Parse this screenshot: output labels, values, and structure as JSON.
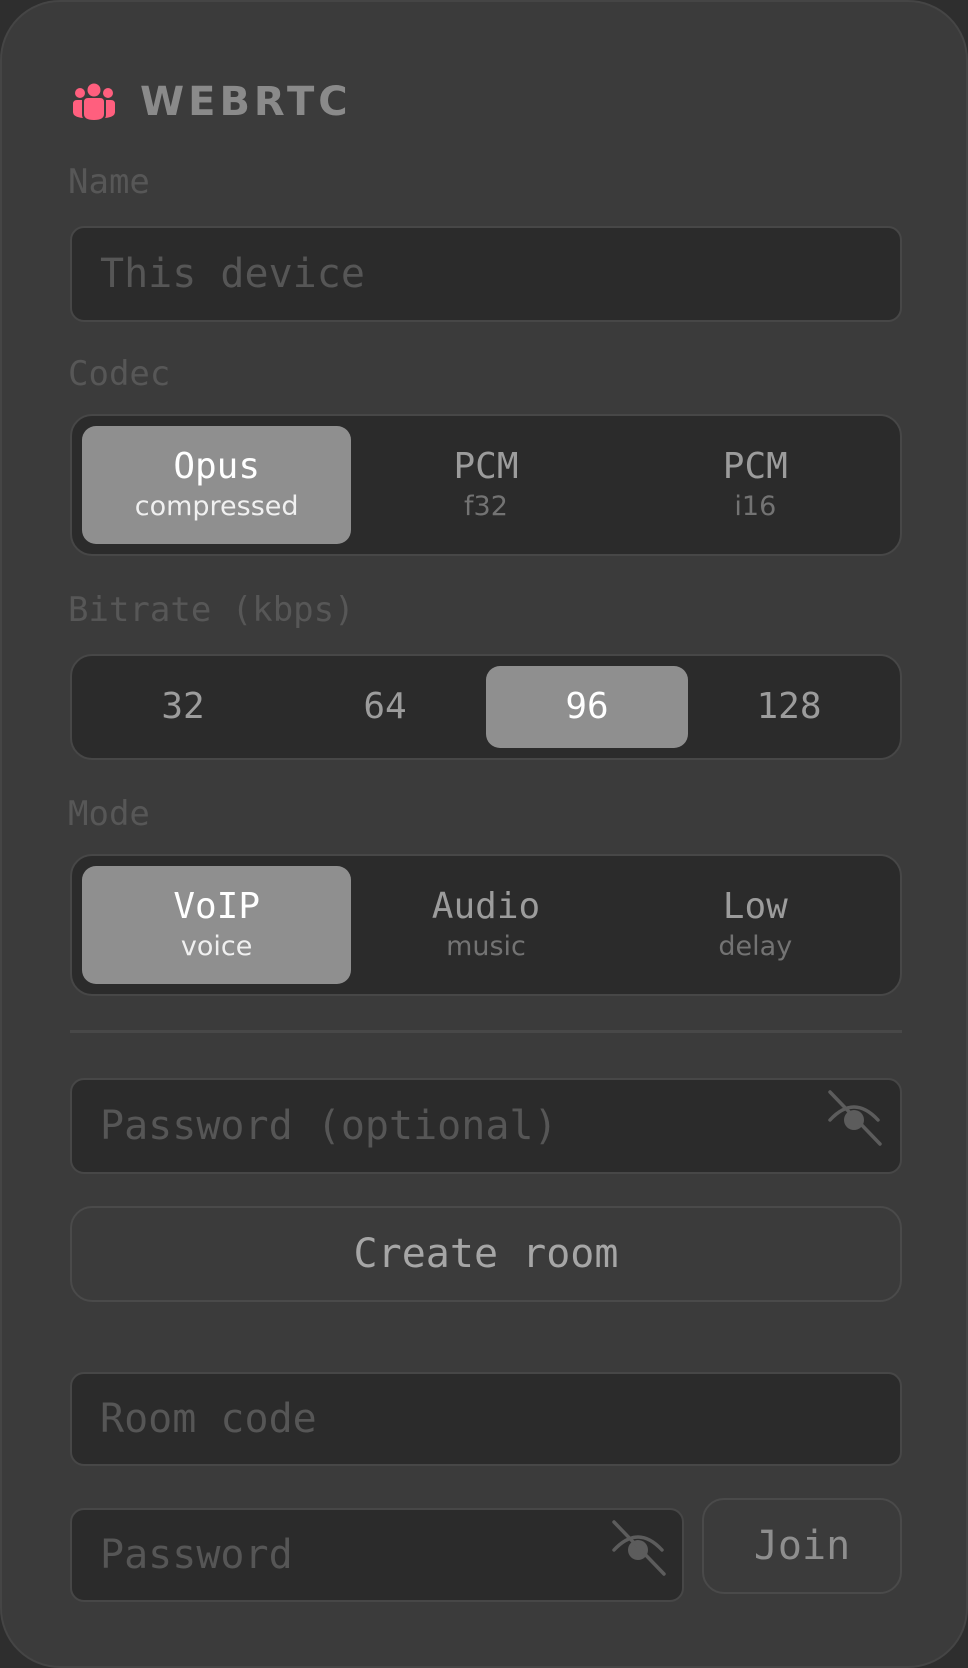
{
  "app": {
    "title": "WEBRTC",
    "logo_icon": "users-group-icon",
    "accent_color": "#ff5f7e"
  },
  "name": {
    "label": "Name",
    "placeholder": "This device",
    "value": ""
  },
  "codec": {
    "label": "Codec",
    "selected": "Opus",
    "options": [
      {
        "main": "Opus",
        "sub": "compressed"
      },
      {
        "main": "PCM",
        "sub": "f32"
      },
      {
        "main": "PCM",
        "sub": "i16"
      }
    ]
  },
  "bitrate": {
    "label": "Bitrate (kbps)",
    "selected": "96",
    "options": [
      "32",
      "64",
      "96",
      "128"
    ]
  },
  "mode": {
    "label": "Mode",
    "selected": "VoIP",
    "options": [
      {
        "main": "VoIP",
        "sub": "voice"
      },
      {
        "main": "Audio",
        "sub": "music"
      },
      {
        "main": "Low",
        "sub": "delay"
      }
    ]
  },
  "create": {
    "password_placeholder": "Password (optional)",
    "visibility_icon": "eye-off-icon",
    "button_label": "Create room"
  },
  "join": {
    "room_code_placeholder": "Room code",
    "password_placeholder": "Password",
    "visibility_icon": "eye-off-icon",
    "button_label": "Join"
  }
}
